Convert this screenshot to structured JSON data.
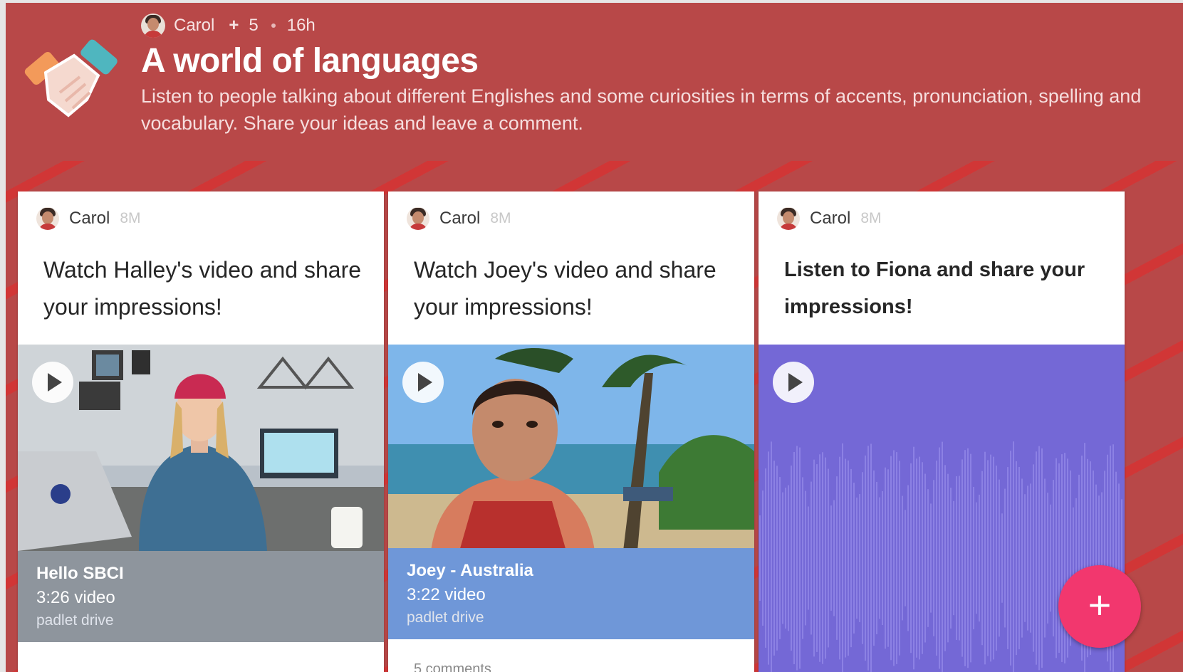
{
  "board": {
    "author": "Carol",
    "plus": "+",
    "collaborators": "5",
    "time": "16h",
    "title": "A world of languages",
    "description": "Listen to people talking about different Englishes and some curiosities in terms of accents, pronunciation, spelling and vocabulary. Share your ideas and leave a comment."
  },
  "cards": [
    {
      "author": "Carol",
      "time": "8M",
      "title": "Watch Halley's video and share your impressions!",
      "caption_title": "Hello SBCI",
      "caption_duration": "3:26 video",
      "caption_source": "padlet drive",
      "caption_color": "#8e959d"
    },
    {
      "author": "Carol",
      "time": "8M",
      "title": "Watch Joey's video and share your impressions!",
      "caption_title": "Joey - Australia",
      "caption_duration": "3:22 video",
      "caption_source": "padlet drive",
      "caption_color": "#6f97d8",
      "comments": "5 comments"
    },
    {
      "author": "Carol",
      "time": "8M",
      "title": "Listen to Fiona and share your impressions!",
      "media_color": "#7468d6"
    }
  ],
  "fab": {
    "label": "+",
    "color": "#f2376e"
  },
  "icons": {
    "logo": "handshake-icon",
    "play": "play-icon",
    "add": "plus-icon"
  }
}
